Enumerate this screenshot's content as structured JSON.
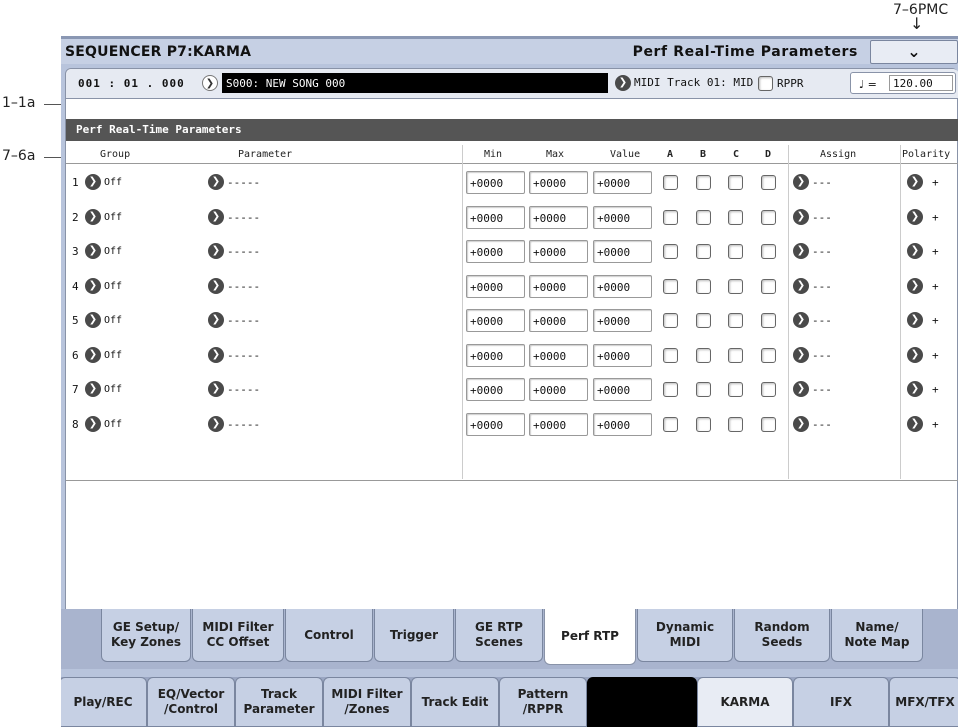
{
  "annotations": {
    "top_right": "7–6PMC",
    "left_1": "1–1a",
    "left_2": "7–6a",
    "arrow_glyph": "↓"
  },
  "header": {
    "title": "SEQUENCER P7:KARMA",
    "page_name": "Perf Real-Time Parameters",
    "menu_glyph": "⌄"
  },
  "status": {
    "location": "001 : 01 . 000",
    "song": "S000: NEW SONG 000",
    "track": "MIDI Track 01: MID",
    "rppr_label": "RPPR",
    "tempo_label": "♩ =",
    "tempo_value": "120.00"
  },
  "section_title": "Perf Real-Time Parameters",
  "columns": {
    "group": "Group",
    "parameter": "Parameter",
    "min": "Min",
    "max": "Max",
    "value": "Value",
    "a": "A",
    "b": "B",
    "c": "C",
    "d": "D",
    "assign": "Assign",
    "polarity": "Polarity"
  },
  "rows": [
    {
      "num": "1",
      "group": "Off",
      "param": "-----",
      "min": "+0000",
      "max": "+0000",
      "value": "+0000",
      "assign": "---",
      "polarity": "+"
    },
    {
      "num": "2",
      "group": "Off",
      "param": "-----",
      "min": "+0000",
      "max": "+0000",
      "value": "+0000",
      "assign": "---",
      "polarity": "+"
    },
    {
      "num": "3",
      "group": "Off",
      "param": "-----",
      "min": "+0000",
      "max": "+0000",
      "value": "+0000",
      "assign": "---",
      "polarity": "+"
    },
    {
      "num": "4",
      "group": "Off",
      "param": "-----",
      "min": "+0000",
      "max": "+0000",
      "value": "+0000",
      "assign": "---",
      "polarity": "+"
    },
    {
      "num": "5",
      "group": "Off",
      "param": "-----",
      "min": "+0000",
      "max": "+0000",
      "value": "+0000",
      "assign": "---",
      "polarity": "+"
    },
    {
      "num": "6",
      "group": "Off",
      "param": "-----",
      "min": "+0000",
      "max": "+0000",
      "value": "+0000",
      "assign": "---",
      "polarity": "+"
    },
    {
      "num": "7",
      "group": "Off",
      "param": "-----",
      "min": "+0000",
      "max": "+0000",
      "value": "+0000",
      "assign": "---",
      "polarity": "+"
    },
    {
      "num": "8",
      "group": "Off",
      "param": "-----",
      "min": "+0000",
      "max": "+0000",
      "value": "+0000",
      "assign": "---",
      "polarity": "+"
    }
  ],
  "sub_tabs": [
    {
      "l1": "GE Setup/",
      "l2": "Key Zones"
    },
    {
      "l1": "MIDI Filter",
      "l2": "CC Offset"
    },
    {
      "l1": "Control",
      "l2": ""
    },
    {
      "l1": "Trigger",
      "l2": ""
    },
    {
      "l1": "GE RTP",
      "l2": "Scenes"
    },
    {
      "l1": "Perf RTP",
      "l2": ""
    },
    {
      "l1": "Dynamic",
      "l2": "MIDI"
    },
    {
      "l1": "Random",
      "l2": "Seeds"
    },
    {
      "l1": "Name/",
      "l2": "Note Map"
    }
  ],
  "main_tabs": [
    {
      "l1": "Play/REC",
      "l2": ""
    },
    {
      "l1": "EQ/Vector",
      "l2": "/Control"
    },
    {
      "l1": "Track",
      "l2": "Parameter"
    },
    {
      "l1": "MIDI Filter",
      "l2": "/Zones"
    },
    {
      "l1": "Track Edit",
      "l2": ""
    },
    {
      "l1": "Pattern",
      "l2": "/RPPR"
    },
    {
      "l1": "",
      "l2": ""
    },
    {
      "l1": "KARMA",
      "l2": ""
    },
    {
      "l1": "IFX",
      "l2": ""
    },
    {
      "l1": "MFX/TFX",
      "l2": ""
    }
  ],
  "glyphs": {
    "arrow": "❯"
  }
}
